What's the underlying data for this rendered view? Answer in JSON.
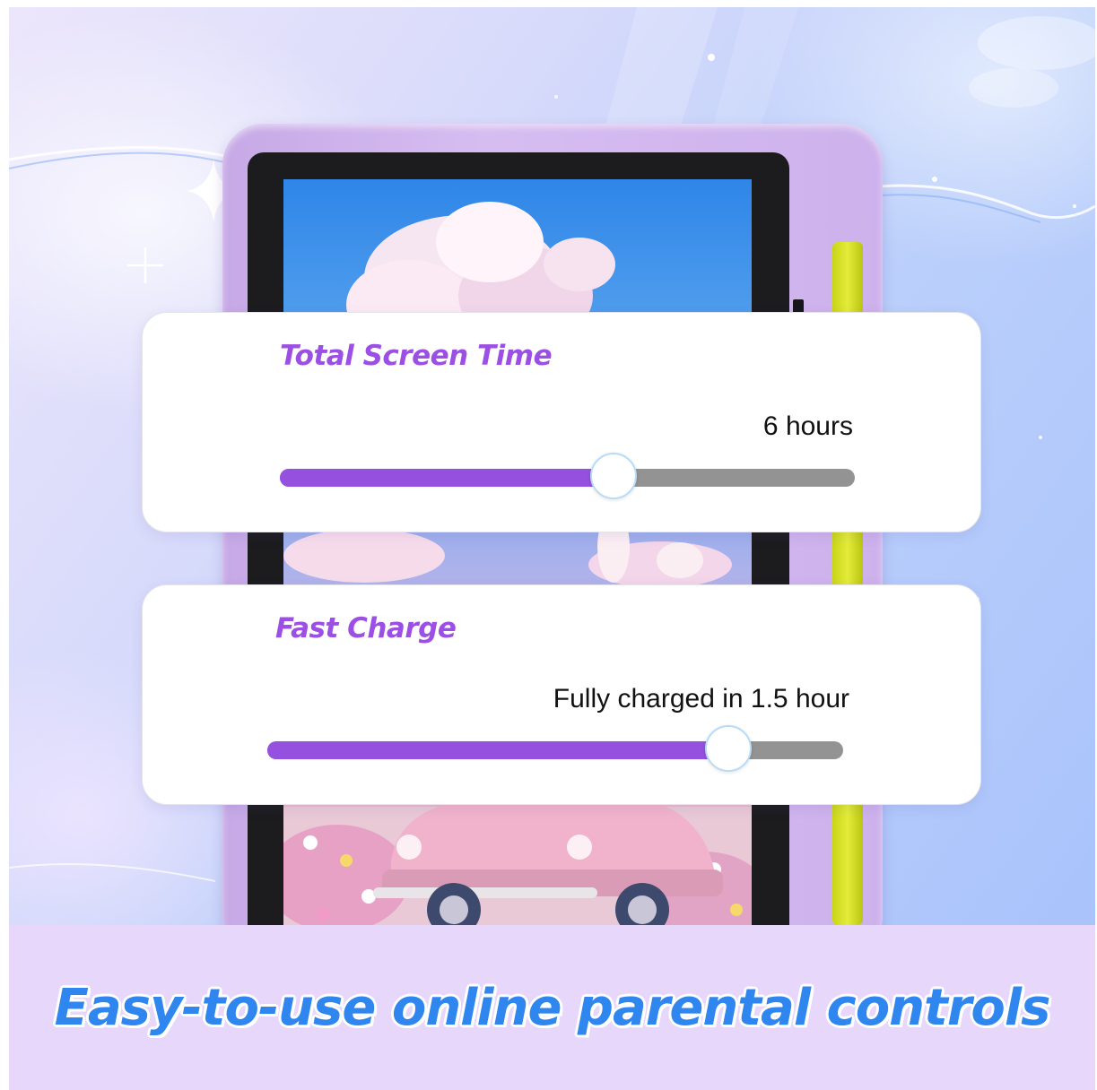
{
  "screen_time_card": {
    "title": "Total Screen Time",
    "value": "6 hours",
    "slider_fraction": 0.58
  },
  "fast_charge_card": {
    "title": "Fast Charge",
    "value": "Fully charged in 1.5 hour",
    "slider_fraction": 0.8
  },
  "banner": {
    "tagline": "Easy-to-use online parental controls"
  },
  "colors": {
    "title_purple": "#9c4fe4",
    "slider_fill": "#9550e0",
    "slider_track": "#939393",
    "tagline_blue": "#2f86ef",
    "banner_bg": "#e7d7fb",
    "case_lilac": "#d3b8ef",
    "stylus_yellow": "#dce53a"
  },
  "icons": {
    "sparkle": "sparkle-icon",
    "plus_star": "plus-star-icon"
  }
}
